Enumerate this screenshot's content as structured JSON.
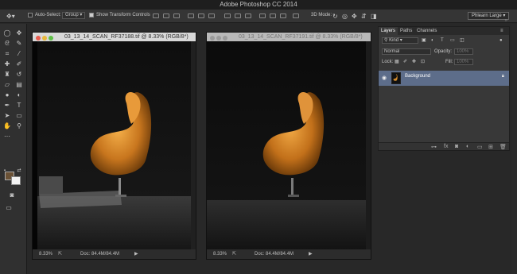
{
  "app": {
    "title": "Adobe Photoshop CC 2014"
  },
  "options_bar": {
    "auto_select_label": "Auto-Select:",
    "auto_select_value": "Group",
    "show_transform_label": "Show Transform Controls",
    "mode_3d_label": "3D Mode:",
    "workspace_value": "Phlearn Large"
  },
  "documents": [
    {
      "name": "03_13_14_SCAN_RF37188.tif @ 8.33% (RGB/8*)",
      "zoom": "8.33%",
      "doc_size": "Doc: 84.4M/84.4M",
      "active": true
    },
    {
      "name": "03_13_14_SCAN_RF37191.tif @ 8.33% (RGB/8*)",
      "zoom": "8.33%",
      "doc_size": "Doc: 84.4M/84.4M",
      "active": false
    }
  ],
  "layers_panel": {
    "tabs": [
      "Layers",
      "Paths",
      "Channels"
    ],
    "filter_label": "Kind",
    "blend_mode": "Normal",
    "opacity_label": "Opacity:",
    "opacity_value": "100%",
    "lock_label": "Lock:",
    "fill_label": "Fill:",
    "fill_value": "100%",
    "layer_name": "Background"
  },
  "colors": {
    "foreground": "#6b5236",
    "background": "#f2f2f2",
    "selected_layer": "#5d6d8a"
  }
}
